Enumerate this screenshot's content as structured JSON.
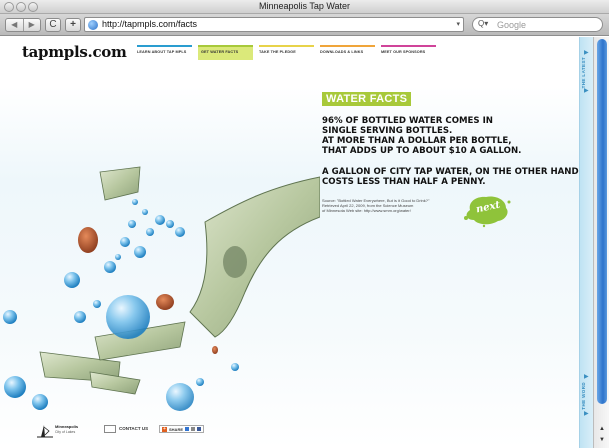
{
  "window": {
    "title": "Minneapolis Tap Water"
  },
  "toolbar": {
    "back": "◀",
    "forward": "▶",
    "reload": "C",
    "add": "+",
    "url": "http://tapmpls.com/facts",
    "search_placeholder": "Google",
    "search_icon": "Q▾"
  },
  "site": {
    "logo": "tapmpls.com",
    "nav": [
      {
        "label": "LEARN ABOUT TAP MPLS",
        "color": "#2a9dd0"
      },
      {
        "label": "GET WATER FACTS",
        "color": "#a8c93a"
      },
      {
        "label": "TAKE THE PLEDGE",
        "color": "#e8d34a"
      },
      {
        "label": "DOWNLOADS & LINKS",
        "color": "#f0a53a"
      },
      {
        "label": "MEET OUR SPONSORS",
        "color": "#d0449a"
      }
    ]
  },
  "content": {
    "badge": "WATER FACTS",
    "fact1": [
      "96% OF BOTTLED WATER COMES IN",
      "SINGLE SERVING BOTTLES.",
      "AT MORE THAN A DOLLAR PER BOTTLE,",
      "THAT ADDS UP TO ABOUT $10 A GALLON."
    ],
    "fact2": [
      "A GALLON OF CITY TAP WATER, ON THE OTHER HAND,",
      "COSTS LESS THAN HALF A PENNY."
    ],
    "source": [
      "Source: \"Bottled Water Everywhere, But is it Good to Drink?\"",
      "Retrieved April 22, 2009, from the Science Museum",
      "of Minnesota Web site: http://www.smm.org/water/"
    ],
    "next": "next",
    "accent": "#a8c93a"
  },
  "footer": {
    "city_name": "Minneapolis",
    "city_sub": "City of Lakes",
    "contact": "CONTACT US",
    "share": "SHARE"
  },
  "sidebar": {
    "latest": "THE LATEST",
    "word": "THE WORD"
  }
}
